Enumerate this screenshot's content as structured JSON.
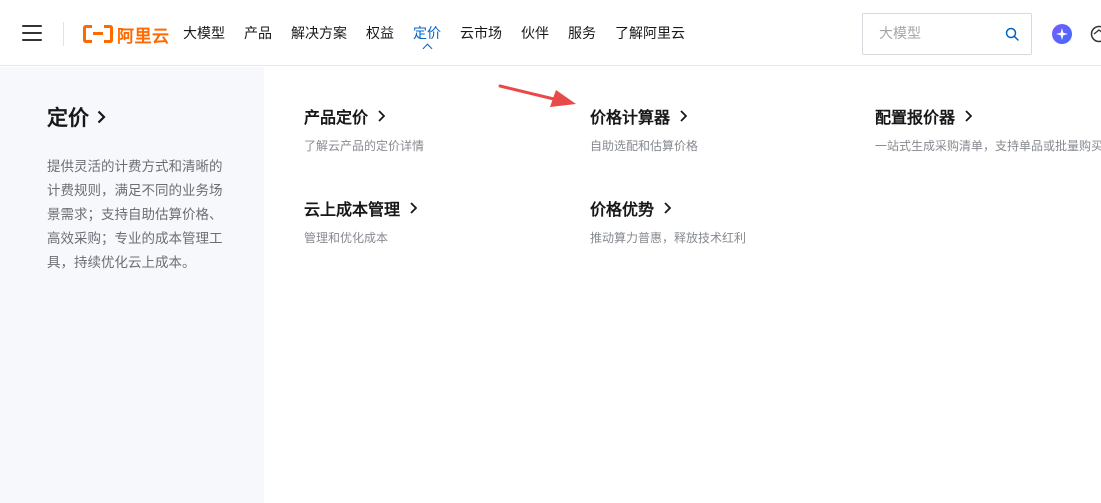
{
  "header": {
    "logo_text": "阿里云",
    "nav": [
      {
        "label": "大模型"
      },
      {
        "label": "产品"
      },
      {
        "label": "解决方案"
      },
      {
        "label": "权益"
      },
      {
        "label": "定价",
        "active": true
      },
      {
        "label": "云市场"
      },
      {
        "label": "伙伴"
      },
      {
        "label": "服务"
      },
      {
        "label": "了解阿里云"
      }
    ],
    "search": {
      "placeholder": "大模型",
      "value": ""
    }
  },
  "menu": {
    "section_title": "定价",
    "section_desc": "提供灵活的计费方式和清晰的计费规则，满足不同的业务场景需求；支持自助估算价格、高效采购；专业的成本管理工具，持续优化云上成本。",
    "items": [
      {
        "title": "产品定价",
        "desc": "了解云产品的定价详情"
      },
      {
        "title": "价格计算器",
        "desc": "自助选配和估算价格"
      },
      {
        "title": "配置报价器",
        "desc": "一站式生成采购清单，支持单品或批量购买"
      },
      {
        "title": "云上成本管理",
        "desc": "管理和优化成本"
      },
      {
        "title": "价格优势",
        "desc": "推动算力普惠，释放技术红利"
      }
    ]
  },
  "colors": {
    "brand": "#ff6a00",
    "active_nav": "#0064c8",
    "annotation_arrow": "#e84a4a",
    "left_panel_bg": "#f6f8fb"
  },
  "icons": [
    "menu-icon",
    "search-icon",
    "ai-assistant-icon",
    "globe-icon",
    "chevron-right-icon",
    "annotation-arrow"
  ]
}
